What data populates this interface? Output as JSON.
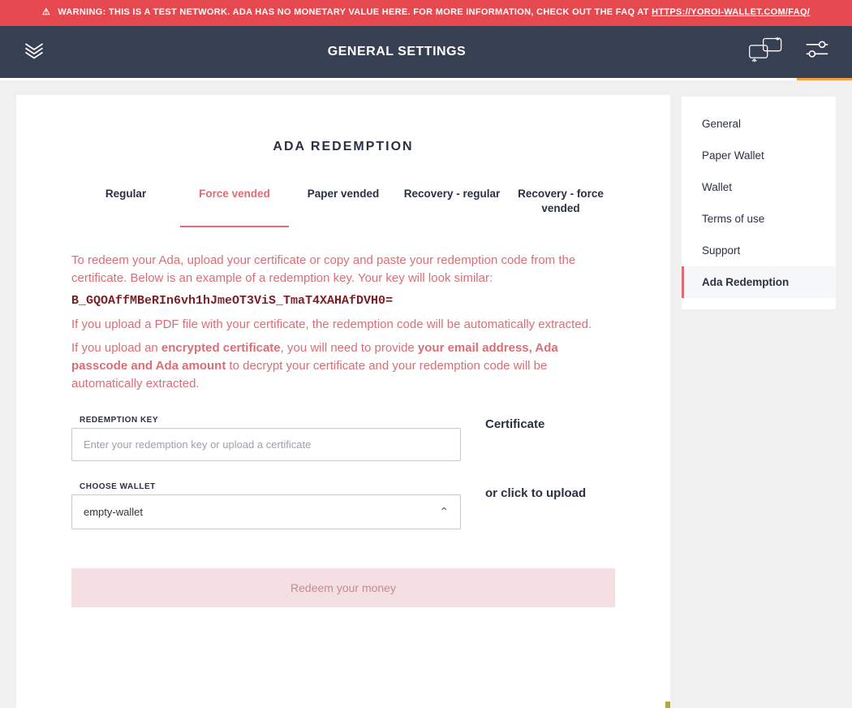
{
  "warning": {
    "icon": "⚠",
    "text": "WARNING: THIS IS A TEST NETWORK. ADA HAS NO MONETARY VALUE HERE. FOR MORE INFORMATION, CHECK OUT THE FAQ AT",
    "link_text": "HTTPS://YOROI-WALLET.COM/FAQ/"
  },
  "header": {
    "title": "GENERAL SETTINGS"
  },
  "sidebar": {
    "items": [
      {
        "label": "General"
      },
      {
        "label": "Paper Wallet"
      },
      {
        "label": "Wallet"
      },
      {
        "label": "Terms of use"
      },
      {
        "label": "Support"
      },
      {
        "label": "Ada Redemption"
      }
    ],
    "active_index": 5
  },
  "panel": {
    "title": "ADA REDEMPTION",
    "tabs": [
      {
        "label": "Regular"
      },
      {
        "label": "Force vended"
      },
      {
        "label": "Paper vended"
      },
      {
        "label": "Recovery - regular"
      },
      {
        "label": "Recovery - force vended"
      }
    ],
    "active_tab": 1,
    "p1": "To redeem your Ada, upload your certificate or copy and paste your redemption code from the certificate. Below is an example of a redemption key. Your key will look similar:",
    "key_example": "B_GQOAffMBeRIn6vh1hJmeOT3ViS_TmaT4XAHAfDVH0=",
    "p2": "If you upload a PDF file with your certificate, the redemption code will be automatically extracted.",
    "p3_pre": "If you upload an ",
    "p3_b1": "encrypted certificate",
    "p3_mid": ", you will need to provide ",
    "p3_b2": "your email address, Ada passcode and Ada amount",
    "p3_post": " to decrypt your certificate and your redemption code will be automatically extracted.",
    "redemption_label": "REDEMPTION KEY",
    "redemption_placeholder": "Enter your redemption key or upload a certificate",
    "choose_wallet_label": "CHOOSE WALLET",
    "choose_wallet_value": "empty-wallet",
    "certificate_title": "Certificate",
    "certificate_or": "or click to upload",
    "submit_label": "Redeem your money"
  }
}
